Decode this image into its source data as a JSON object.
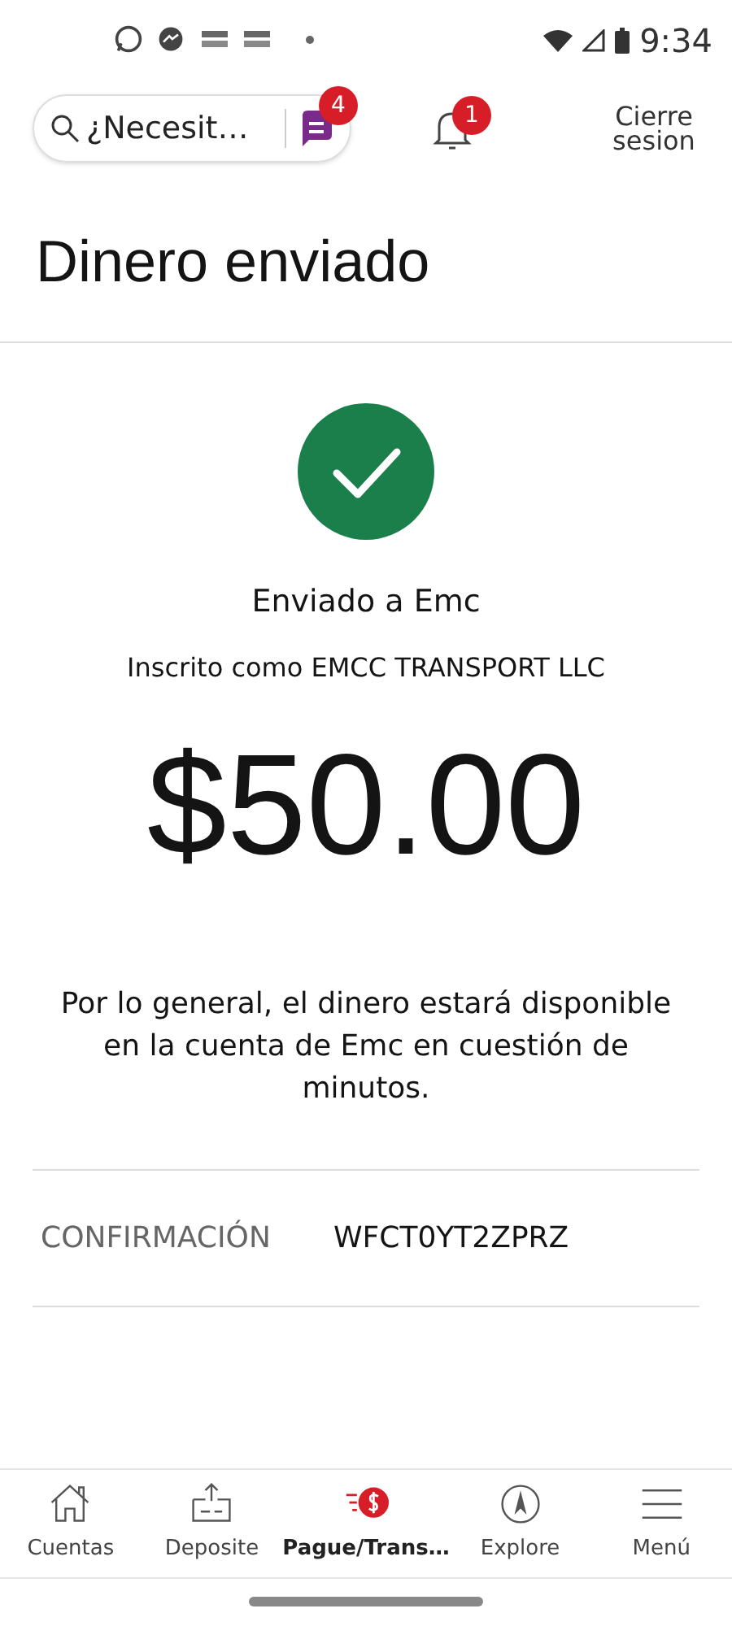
{
  "status_bar": {
    "time": "9:34"
  },
  "header": {
    "search": {
      "placeholder": "¿Necesit…"
    },
    "chat_badge": "4",
    "bell_badge": "1",
    "sign_out": "Cierre sesion"
  },
  "title": "Dinero enviado",
  "result": {
    "sent_to": "Enviado a Emc",
    "enrolled_as": "Inscrito como EMCC TRANSPORT LLC",
    "amount": "$50.00",
    "note": "Por lo general, el dinero estará disponible en la cuenta de Emc en cuestión de minutos."
  },
  "details": [
    {
      "label": "CONFIRMACIÓN",
      "value": "WFCT0YT2ZPRZ"
    }
  ],
  "bottom_nav": [
    {
      "kind": "home",
      "label": "Cuentas",
      "selected": false
    },
    {
      "kind": "deposit",
      "label": "Deposite",
      "selected": false
    },
    {
      "kind": "pay",
      "label": "Pague/Trans…",
      "selected": true
    },
    {
      "kind": "explore",
      "label": "Explore",
      "selected": false
    },
    {
      "kind": "menu",
      "label": "Menú",
      "selected": false
    }
  ]
}
